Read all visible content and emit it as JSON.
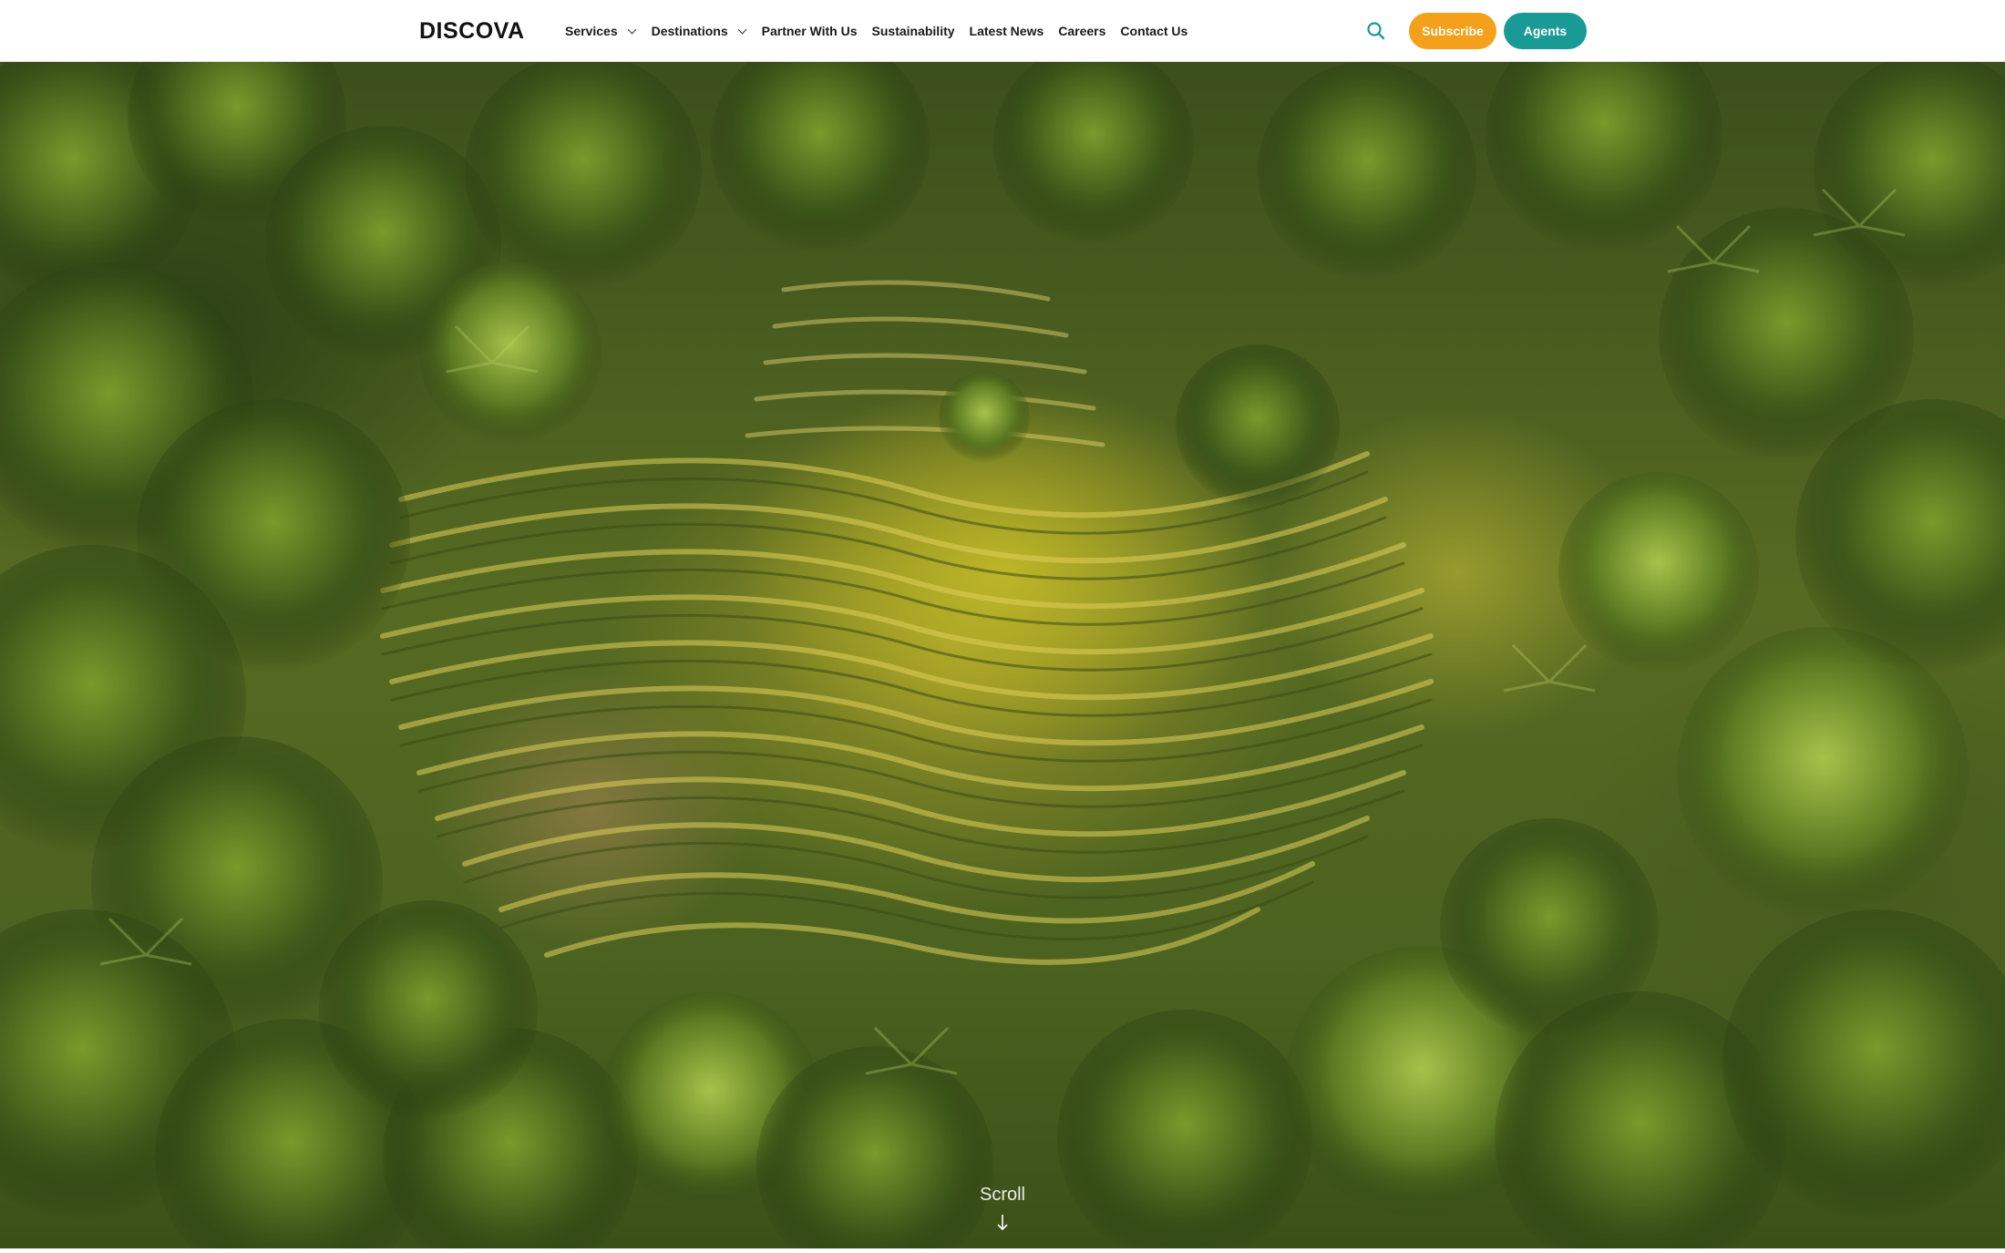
{
  "brand": {
    "logo_text": "DISCOVA"
  },
  "nav": {
    "items": [
      {
        "label": "Services",
        "has_dropdown": true
      },
      {
        "label": "Destinations",
        "has_dropdown": true
      },
      {
        "label": "Partner With Us",
        "has_dropdown": false
      },
      {
        "label": "Sustainability",
        "has_dropdown": false
      },
      {
        "label": "Latest News",
        "has_dropdown": false
      },
      {
        "label": "Careers",
        "has_dropdown": false
      },
      {
        "label": "Contact Us",
        "has_dropdown": false
      }
    ]
  },
  "actions": {
    "search_icon": "search-icon",
    "subscribe_label": "Subscribe",
    "agents_label": "Agents"
  },
  "hero": {
    "image_subject": "aerial view of rice terraces surrounded by palm trees",
    "scroll_label": "Scroll",
    "scroll_icon": "arrow-down-icon"
  },
  "colors": {
    "subscribe": "#f5a01a",
    "agents": "#1a9a94",
    "header_bg": "#ffffff",
    "nav_text": "#1a1a1a"
  }
}
